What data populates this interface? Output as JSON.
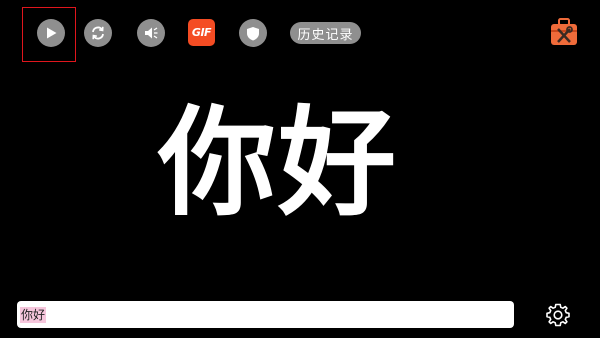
{
  "toolbar": {
    "play": {
      "icon": "play-icon"
    },
    "refresh": {
      "icon": "refresh-icon"
    },
    "mute": {
      "icon": "speaker-muted-icon"
    },
    "gif": {
      "label": "GIF",
      "color": "#f44c23"
    },
    "shield": {
      "icon": "shield-icon"
    },
    "history": {
      "label": "历史记录"
    },
    "toolbox": {
      "icon": "toolbox-icon",
      "color": "#ef6b3a"
    }
  },
  "display": {
    "text": "你好"
  },
  "input": {
    "value": "你好",
    "highlight_color": "#f6c6dc"
  },
  "settings": {
    "icon": "gear-icon"
  },
  "colors": {
    "background": "#000000",
    "button_gray": "#8f8f8f",
    "highlight_border": "#e0161d"
  }
}
